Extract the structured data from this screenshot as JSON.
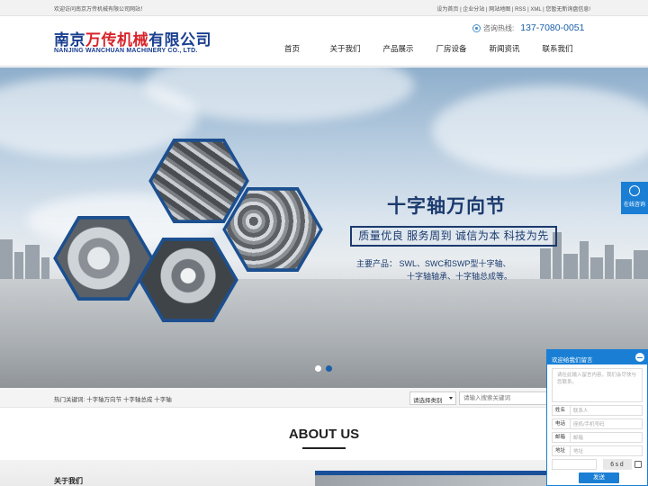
{
  "topbar": {
    "welcome": "欢迎访问南京万传机械有限公司网站！",
    "links": "设为首页 | 企业分站 | 网站地图 | RSS | XML | 您暂无新询盘信息!"
  },
  "header": {
    "logo_cn_pre": "南京",
    "logo_cn_hl": "万传机械",
    "logo_cn_post": "有限公司",
    "logo_en": "NANJING WANCHUAN MACHINERY CO., LTD.",
    "hotline_label": "咨询热线:",
    "hotline_number": "137-7080-0051",
    "phone_icon": "phone-icon"
  },
  "nav": {
    "items": [
      {
        "label": "首页"
      },
      {
        "label": "关于我们"
      },
      {
        "label": "产品展示"
      },
      {
        "label": "厂房设备"
      },
      {
        "label": "新闻资讯"
      },
      {
        "label": "联系我们"
      }
    ]
  },
  "banner": {
    "title": "十字轴万向节",
    "slogan": "质量优良 服务周到 诚信为本 科技为先",
    "products_line1": "主要产品：  SWL、SWC和SWP型十字轴、",
    "products_line2": "十字轴轴承、十字轴总成等。",
    "accent_color": "#1b3a6d"
  },
  "side": {
    "online_label": "在线咨询",
    "icon": "chat-icon"
  },
  "search": {
    "hot_label": "热门关键词:",
    "keywords": "十字轴万向节  十字轴总成  十字轴",
    "category_select": "请选择类别",
    "input_placeholder": "请输入搜索关键词"
  },
  "about": {
    "title": "ABOUT US",
    "subtitle": "关于我们"
  },
  "message_box": {
    "title": "欢迎给我们留言",
    "content_placeholder": "请在此输入留言内容，我们会尽快与您联系。",
    "fields": [
      {
        "label": "姓名",
        "placeholder": "联系人"
      },
      {
        "label": "电话",
        "placeholder": "座机/手机号码"
      },
      {
        "label": "邮箱",
        "placeholder": "邮箱"
      },
      {
        "label": "地址",
        "placeholder": "地址"
      }
    ],
    "captcha": "6sd",
    "send_label": "发送"
  }
}
